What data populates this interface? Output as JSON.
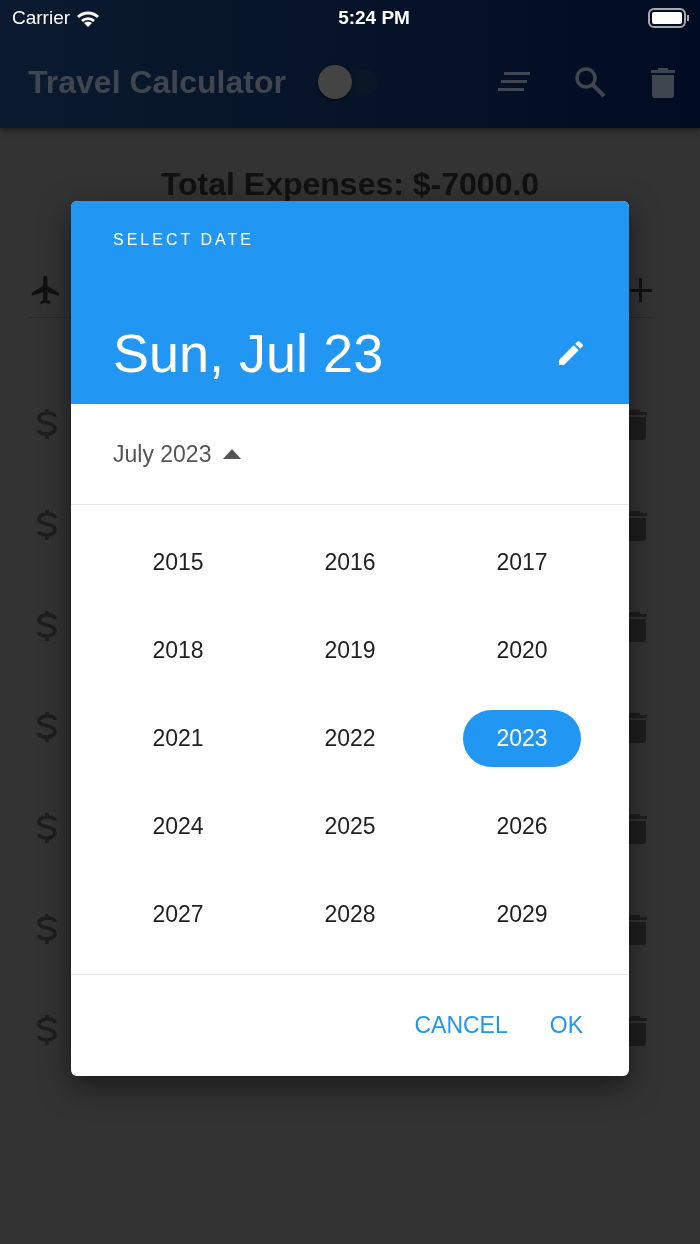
{
  "status_bar": {
    "carrier": "Carrier",
    "time": "5:24 PM"
  },
  "app_bar": {
    "title": "Travel Calculator",
    "toggle": {
      "on": false
    }
  },
  "total": "Total Expenses: $-7000.0",
  "expense_rows": [
    {
      "kind": "expense"
    },
    {
      "kind": "expense"
    },
    {
      "kind": "expense"
    },
    {
      "kind": "expense"
    },
    {
      "kind": "expense"
    },
    {
      "kind": "expense"
    },
    {
      "kind": "expense"
    }
  ],
  "date_dialog": {
    "header_label": "SELECT DATE",
    "selected_date": "Sun, Jul 23",
    "month": "July 2023",
    "month_expanded": true,
    "years": [
      {
        "label": "2015",
        "selected": false
      },
      {
        "label": "2016",
        "selected": false
      },
      {
        "label": "2017",
        "selected": false
      },
      {
        "label": "2018",
        "selected": false
      },
      {
        "label": "2019",
        "selected": false
      },
      {
        "label": "2020",
        "selected": false
      },
      {
        "label": "2021",
        "selected": false
      },
      {
        "label": "2022",
        "selected": false
      },
      {
        "label": "2023",
        "selected": true
      },
      {
        "label": "2024",
        "selected": false
      },
      {
        "label": "2025",
        "selected": false
      },
      {
        "label": "2026",
        "selected": false
      },
      {
        "label": "2027",
        "selected": false
      },
      {
        "label": "2028",
        "selected": false
      },
      {
        "label": "2029",
        "selected": false
      }
    ],
    "actions": [
      "CANCEL",
      "OK"
    ]
  }
}
